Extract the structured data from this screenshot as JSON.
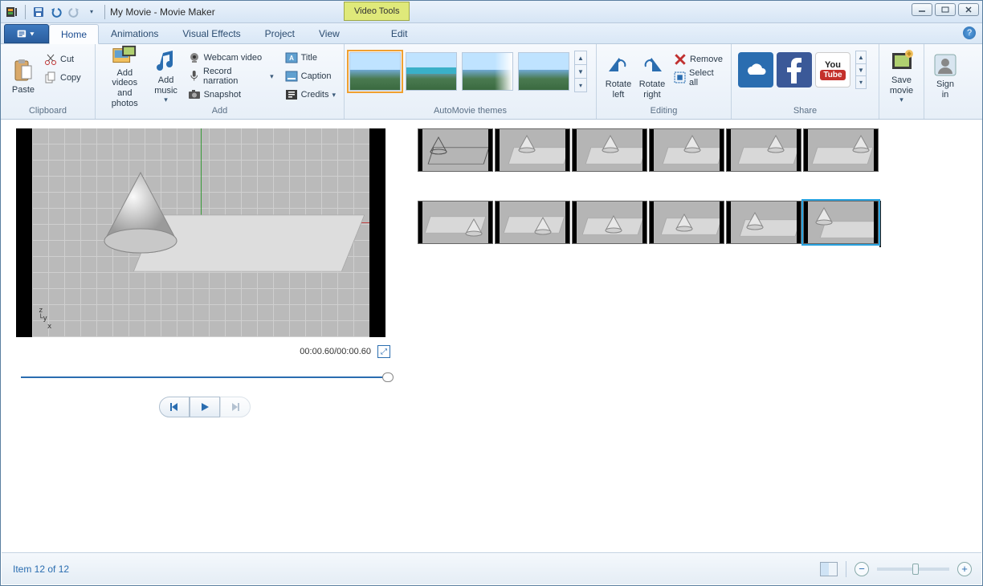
{
  "title": "My Movie - Movie Maker",
  "context_tab": "Video Tools",
  "tabs": {
    "home": "Home",
    "animations": "Animations",
    "visual_effects": "Visual Effects",
    "project": "Project",
    "view": "View",
    "edit": "Edit"
  },
  "ribbon": {
    "clipboard": {
      "label": "Clipboard",
      "paste": "Paste",
      "cut": "Cut",
      "copy": "Copy"
    },
    "add": {
      "label": "Add",
      "add_videos": "Add videos\nand photos",
      "add_music": "Add\nmusic",
      "webcam": "Webcam video",
      "narration": "Record narration",
      "snapshot": "Snapshot",
      "title": "Title",
      "caption": "Caption",
      "credits": "Credits"
    },
    "automovie": {
      "label": "AutoMovie themes"
    },
    "editing": {
      "label": "Editing",
      "rotate_left": "Rotate\nleft",
      "rotate_right": "Rotate\nright",
      "remove": "Remove",
      "select_all": "Select all"
    },
    "share": {
      "label": "Share"
    },
    "save": {
      "label": "Save\nmovie"
    },
    "signin": {
      "label": "Sign\nin"
    }
  },
  "preview": {
    "time": "00:00.60/00:00.60"
  },
  "status": {
    "text": "Item 12 of 12"
  }
}
